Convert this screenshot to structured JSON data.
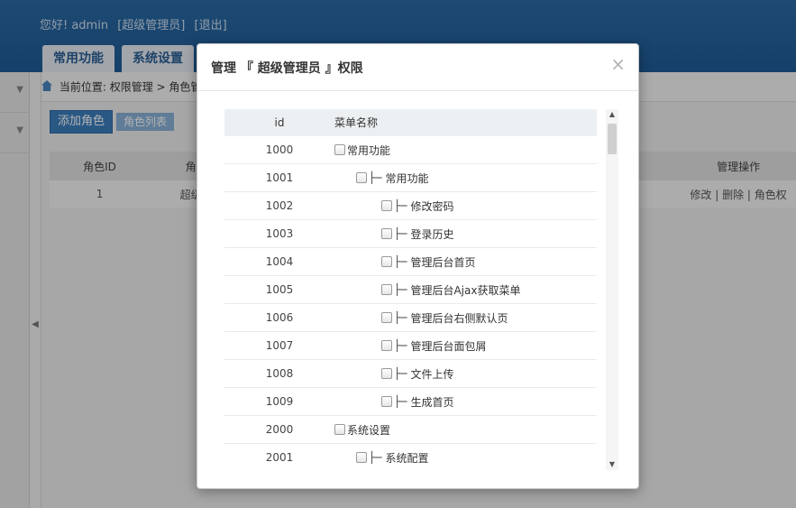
{
  "header": {
    "greeting": "您好! admin",
    "role": "[超级管理员]",
    "logout": "[退出]",
    "tabs": [
      "常用功能",
      "系统设置"
    ]
  },
  "breadcrumb": {
    "prefix": "当前位置:",
    "path": "权限管理 > 角色管"
  },
  "toolbar": {
    "add_role": "添加角色",
    "role_list": "角色列表"
  },
  "role_table": {
    "headers": [
      "角色ID",
      "角",
      "管理操作"
    ],
    "row": {
      "id": "1",
      "name": "超级",
      "actions": "修改 | 删除 | 角色权"
    }
  },
  "dialog": {
    "title": "管理 『 超级管理员 』权限",
    "close": "×",
    "columns": {
      "id": "id",
      "name": "菜单名称"
    },
    "rows": [
      {
        "id": "1000",
        "level": 0,
        "name": "常用功能"
      },
      {
        "id": "1001",
        "level": 1,
        "name": "常用功能"
      },
      {
        "id": "1002",
        "level": 2,
        "name": "修改密码"
      },
      {
        "id": "1003",
        "level": 2,
        "name": "登录历史"
      },
      {
        "id": "1004",
        "level": 2,
        "name": "管理后台首页"
      },
      {
        "id": "1005",
        "level": 2,
        "name": "管理后台Ajax获取菜单"
      },
      {
        "id": "1006",
        "level": 2,
        "name": "管理后台右侧默认页"
      },
      {
        "id": "1007",
        "level": 2,
        "name": "管理后台面包屑"
      },
      {
        "id": "1008",
        "level": 2,
        "name": "文件上传"
      },
      {
        "id": "1009",
        "level": 2,
        "name": "生成首页"
      },
      {
        "id": "2000",
        "level": 0,
        "name": "系统设置"
      },
      {
        "id": "2001",
        "level": 1,
        "name": "系统配置"
      }
    ],
    "tree_prefix": "├─"
  }
}
